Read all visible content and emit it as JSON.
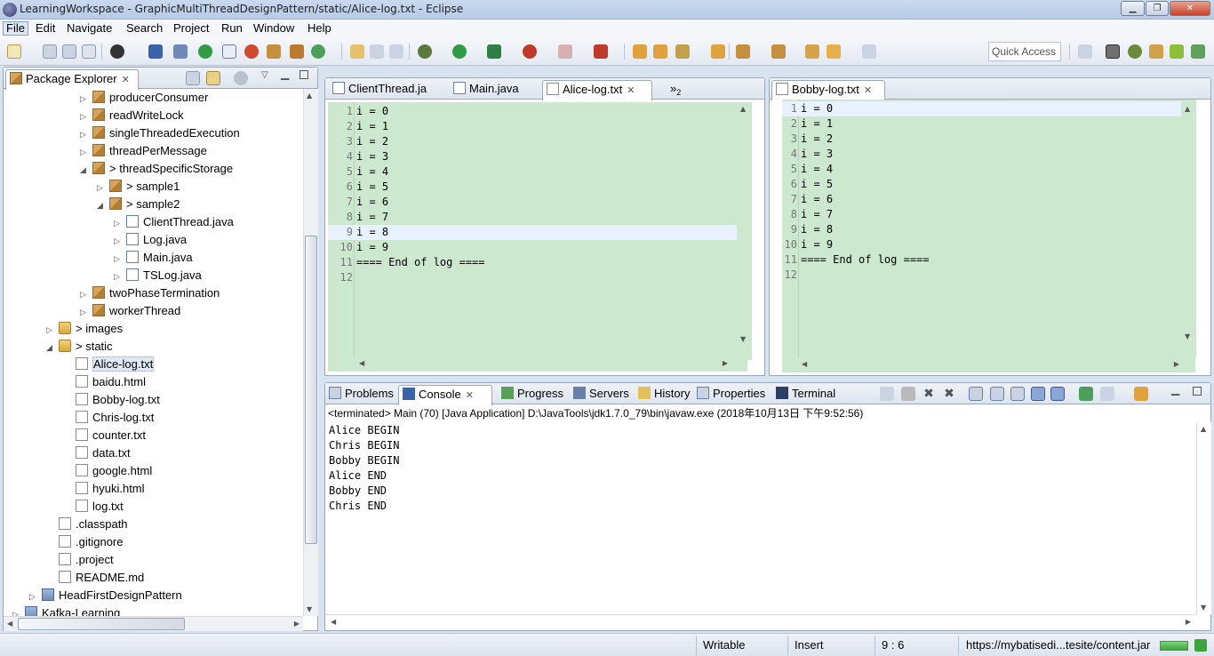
{
  "window": {
    "title": "LearningWorkspace - GraphicMultiThreadDesignPattern/static/Alice-log.txt - Eclipse",
    "minimize": "▁",
    "maximize": "❐",
    "close": "✕"
  },
  "menu": [
    "File",
    "Edit",
    "Navigate",
    "Search",
    "Project",
    "Run",
    "Window",
    "Help"
  ],
  "toolbar": {
    "quick_access_placeholder": "Quick Access"
  },
  "package_explorer": {
    "title": "Package Explorer",
    "items": [
      {
        "label": "producerConsumer",
        "icon": "package-icon",
        "level": 4,
        "expanded": false
      },
      {
        "label": "readWriteLock",
        "icon": "package-icon",
        "level": 4,
        "expanded": false
      },
      {
        "label": "singleThreadedExecution",
        "icon": "package-icon",
        "level": 4,
        "expanded": false
      },
      {
        "label": "threadPerMessage",
        "icon": "package-icon",
        "level": 4,
        "expanded": false
      },
      {
        "label": "> threadSpecificStorage",
        "icon": "package-icon",
        "level": 4,
        "expanded": true
      },
      {
        "label": "> sample1",
        "icon": "package-icon",
        "level": 5,
        "expanded": false
      },
      {
        "label": "> sample2",
        "icon": "package-icon",
        "level": 5,
        "expanded": true
      },
      {
        "label": "ClientThread.java",
        "icon": "java-file-icon",
        "level": 6,
        "expanded": false
      },
      {
        "label": "Log.java",
        "icon": "java-file-icon",
        "level": 6,
        "expanded": false
      },
      {
        "label": "Main.java",
        "icon": "java-file-icon",
        "level": 6,
        "expanded": false
      },
      {
        "label": "TSLog.java",
        "icon": "java-file-icon",
        "level": 6,
        "expanded": false
      },
      {
        "label": "twoPhaseTermination",
        "icon": "package-icon",
        "level": 4,
        "expanded": false
      },
      {
        "label": "workerThread",
        "icon": "package-icon",
        "level": 4,
        "expanded": false
      },
      {
        "label": "> images",
        "icon": "folder-icon",
        "level": 2,
        "expanded": false
      },
      {
        "label": "> static",
        "icon": "folder-icon",
        "level": 2,
        "expanded": true
      },
      {
        "label": "Alice-log.txt",
        "icon": "text-file-icon",
        "level": 3,
        "selected": true
      },
      {
        "label": "baidu.html",
        "icon": "text-file-icon",
        "level": 3
      },
      {
        "label": "Bobby-log.txt",
        "icon": "text-file-icon",
        "level": 3
      },
      {
        "label": "Chris-log.txt",
        "icon": "text-file-icon",
        "level": 3
      },
      {
        "label": "counter.txt",
        "icon": "text-file-icon",
        "level": 3
      },
      {
        "label": "data.txt",
        "icon": "text-file-icon",
        "level": 3
      },
      {
        "label": "google.html",
        "icon": "text-file-icon",
        "level": 3
      },
      {
        "label": "hyuki.html",
        "icon": "text-file-icon",
        "level": 3
      },
      {
        "label": "log.txt",
        "icon": "text-file-icon",
        "level": 3
      },
      {
        "label": ".classpath",
        "icon": "xml-file-icon",
        "level": 2
      },
      {
        "label": ".gitignore",
        "icon": "text-file-icon",
        "level": 2
      },
      {
        "label": ".project",
        "icon": "xml-file-icon",
        "level": 2
      },
      {
        "label": "README.md",
        "icon": "text-file-icon",
        "level": 2
      },
      {
        "label": "HeadFirstDesignPattern",
        "icon": "project-icon",
        "level": 1
      },
      {
        "label": "Kafka-Learning",
        "icon": "project-icon",
        "level": 0
      }
    ]
  },
  "left_editor": {
    "tabs": [
      {
        "label": "ClientThread.ja",
        "icon": "java-file-icon",
        "active": false
      },
      {
        "label": "Main.java",
        "icon": "java-file-icon",
        "active": false
      },
      {
        "label": "Alice-log.txt",
        "icon": "text-file-icon",
        "active": true
      }
    ],
    "overflow_label": "»",
    "overflow_count": "2",
    "lines": [
      "i = 0",
      "i = 1",
      "i = 2",
      "i = 3",
      "i = 4",
      "i = 5",
      "i = 6",
      "i = 7",
      "i = 8",
      "i = 9",
      "==== End of log ====",
      ""
    ],
    "current_line": 9
  },
  "right_editor": {
    "tabs": [
      {
        "label": "Bobby-log.txt",
        "icon": "text-file-icon",
        "active": true
      }
    ],
    "lines": [
      "i = 0",
      "i = 1",
      "i = 2",
      "i = 3",
      "i = 4",
      "i = 5",
      "i = 6",
      "i = 7",
      "i = 8",
      "i = 9",
      "==== End of log ====",
      ""
    ],
    "current_line": 1
  },
  "bottom_panel": {
    "tabs": [
      {
        "label": "Problems",
        "icon": "problems-icon",
        "active": false
      },
      {
        "label": "Console",
        "icon": "console-icon",
        "active": true
      },
      {
        "label": "Progress",
        "icon": "progress-icon",
        "active": false
      },
      {
        "label": "Servers",
        "icon": "servers-icon",
        "active": false
      },
      {
        "label": "History",
        "icon": "history-icon",
        "active": false
      },
      {
        "label": "Properties",
        "icon": "properties-icon",
        "active": false
      },
      {
        "label": "Terminal",
        "icon": "terminal-icon",
        "active": false
      }
    ],
    "console_header": "<terminated> Main (70) [Java Application] D:\\JavaTools\\jdk1.7.0_79\\bin\\javaw.exe (2018年10月13日 下午9:52:56)",
    "console_lines": [
      "Alice BEGIN",
      "Chris BEGIN",
      "Bobby BEGIN",
      "Alice END",
      "Bobby END",
      "Chris END"
    ]
  },
  "status_bar": {
    "writable": "Writable",
    "insert_mode": "Insert",
    "cursor_position": "9 : 6",
    "status_message": "https://mybatisedi...tesite/content.jar"
  },
  "colors": {
    "editor_background": "#cce8cf",
    "current_line": "#e8f2fe",
    "selection": "#dfe9f5"
  }
}
